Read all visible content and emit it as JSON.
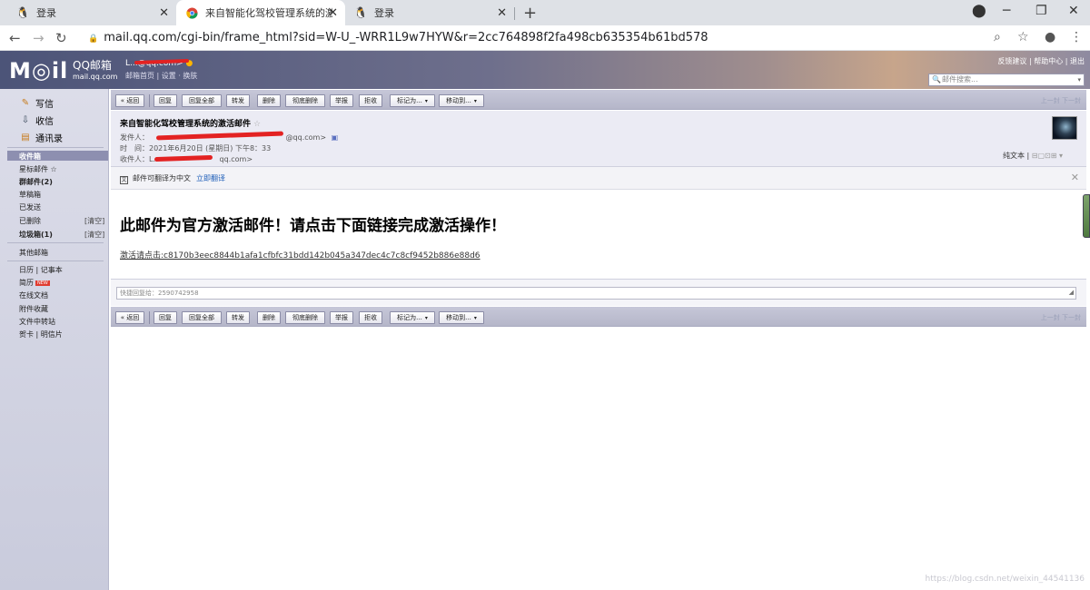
{
  "browser": {
    "tabs": [
      {
        "title": "登录",
        "active": false
      },
      {
        "title": "来自智能化驾校管理系统的激活邮件",
        "active": true
      },
      {
        "title": "登录",
        "active": false
      }
    ],
    "url": "mail.qq.com/cgi-bin/frame_html?sid=W-U_-WRR1L9w7HYW&r=2cc764898f2fa498cb635354b61bd578"
  },
  "header": {
    "logo_text": "M◎il",
    "brand": "QQ邮箱",
    "brand_domain": "mail.qq.com",
    "account": "L...@qq.com>",
    "links": "邮箱首页 | 设置 · 换肤",
    "top_links": "反馈建议 | 帮助中心 | 退出",
    "search_placeholder": "邮件搜索..."
  },
  "sidebar": {
    "compose": "写信",
    "inbox_main": "收信",
    "contacts": "通讯录",
    "folders": [
      {
        "label": "收件箱",
        "right": ""
      },
      {
        "label": "星标邮件 ☆",
        "right": ""
      },
      {
        "label": "群邮件(2)",
        "right": ""
      },
      {
        "label": "草稿箱",
        "right": ""
      },
      {
        "label": "已发送",
        "right": ""
      },
      {
        "label": "已删除",
        "right": "[清空]"
      },
      {
        "label": "垃圾箱(1)",
        "right": "[清空]"
      }
    ],
    "other": "其他邮箱",
    "extras": [
      {
        "label": "日历 | 记事本"
      },
      {
        "label": "简历"
      },
      {
        "label": "在线文档"
      },
      {
        "label": "附件收藏"
      },
      {
        "label": "文件中转站"
      },
      {
        "label": "贺卡 | 明信片"
      }
    ],
    "new_badge": "NEW"
  },
  "toolbar": {
    "back": "« 返回",
    "reply": "回复",
    "reply_all": "回复全部",
    "forward": "转发",
    "delete": "删除",
    "delete_perm": "彻底删除",
    "report": "举报",
    "reject": "拒收",
    "mark_as": "标记为...",
    "move_to": "移动到...",
    "pager": "上一封 下一封"
  },
  "mail": {
    "subject": "来自智能化驾校管理系统的激活邮件",
    "star": "☆",
    "from_label": "发件人：",
    "from_tail": "@qq.com>",
    "time_label": "时　间：",
    "time_value": "2021年6月20日 (星期日) 下午8：33",
    "to_label": "收件人：",
    "to_tail": "L.",
    "to_domain": "qq.com>",
    "view_options": "纯文本 | ",
    "translate_text": "邮件可翻译为中文",
    "translate_link": "立即翻译",
    "body_title": "此邮件为官方激活邮件！请点击下面链接完成激活操作！",
    "activation_link": "激活请点击:c8170b3eec8844b1afa1cfbfc31bdd142b045a347dec4c7c8cf9452b886e88d6",
    "quick_reply": "快捷回复给：2590742958"
  },
  "watermark": "https://blog.csdn.net/weixin_44541136"
}
